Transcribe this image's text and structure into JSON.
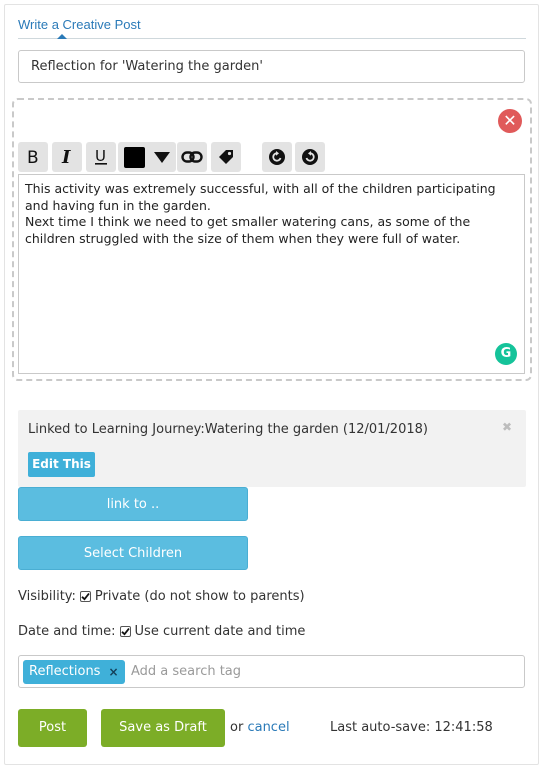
{
  "tab": {
    "label": "Write a Creative Post"
  },
  "title_field": {
    "value": "Reflection for 'Watering the garden'"
  },
  "editor": {
    "toolbar": [
      "bold-icon",
      "italic-icon",
      "underline-icon",
      "text-color-icon",
      "dropdown-arrow-icon",
      "link-icon",
      "tag-icon",
      "undo-icon",
      "redo-icon"
    ],
    "paragraphs": [
      "This activity was extremely successful, with all of the children participating and having fun in the garden.",
      "Next time I think we need to get smaller watering cans, as some of the children struggled with the size of them when they were full of water."
    ],
    "close_icon": "close-icon",
    "grammarly_icon": "grammarly-icon",
    "grammarly_letter": "G"
  },
  "linked": {
    "text": "Linked to Learning Journey:Watering the garden (12/01/2018)",
    "remove_icon": "✖",
    "edit_label": "Edit This"
  },
  "buttons": {
    "link_to": "link to ..",
    "select_children": "Select Children"
  },
  "visibility": {
    "label": "Visibility:",
    "option": "Private (do not show to parents)"
  },
  "datetime": {
    "label": "Date and time:",
    "option": "Use current date and time"
  },
  "tags": {
    "items": [
      {
        "label": "Reflections",
        "remove": "×"
      }
    ],
    "placeholder": "Add a search tag"
  },
  "footer": {
    "post": "Post",
    "draft": "Save as Draft",
    "or": "or",
    "cancel": "cancel",
    "autosave_label": "Last auto-save:",
    "autosave_time": "12:41:58"
  },
  "colors": {
    "accent_blue": "#2a7ab8",
    "button_blue": "#5bbde0",
    "tag_blue": "#3fb0d9",
    "green": "#7cad27",
    "close_red": "#e05a5a",
    "grammarly_green": "#15c39a"
  }
}
